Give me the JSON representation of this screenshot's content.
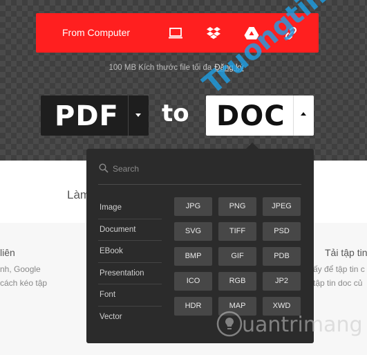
{
  "upload": {
    "label": "From Computer",
    "sources": [
      {
        "name": "computer-icon"
      },
      {
        "name": "dropbox-icon"
      },
      {
        "name": "google-drive-icon"
      },
      {
        "name": "url-link-icon"
      }
    ],
    "limit_text": "100 MB Kích thước file tối đa",
    "signup_link": "Đăng ký"
  },
  "converter": {
    "from_format": "PDF",
    "to_word": "to",
    "to_format": "DOC"
  },
  "dropdown": {
    "search_placeholder": "Search",
    "categories": [
      "Image",
      "Document",
      "EBook",
      "Presentation",
      "Font",
      "Vector"
    ],
    "formats": [
      "JPG",
      "PNG",
      "JPEG",
      "SVG",
      "TIFF",
      "PSD",
      "BMP",
      "GIF",
      "PDB",
      "ICO",
      "RGB",
      "JP2",
      "HDR",
      "MAP",
      "XWD"
    ]
  },
  "background": {
    "left_heading": "Làm",
    "left_title": "liên",
    "left_line1": "nh, Google",
    "left_line2": "cách kéo tập",
    "right_title": "Tải tập tin",
    "right_line1": "ấy để tập tin c",
    "right_line2": "tập tin doc củ"
  },
  "watermarks": {
    "diagonal": "Truongtin.top",
    "bottom": "uantrimang"
  },
  "colors": {
    "accent": "#ff1f1f",
    "dropdown_bg": "#2b2b2b",
    "format_button": "#474747",
    "hero_bg": "#3f3f3f",
    "watermark_blue": "#1ea0e6"
  }
}
